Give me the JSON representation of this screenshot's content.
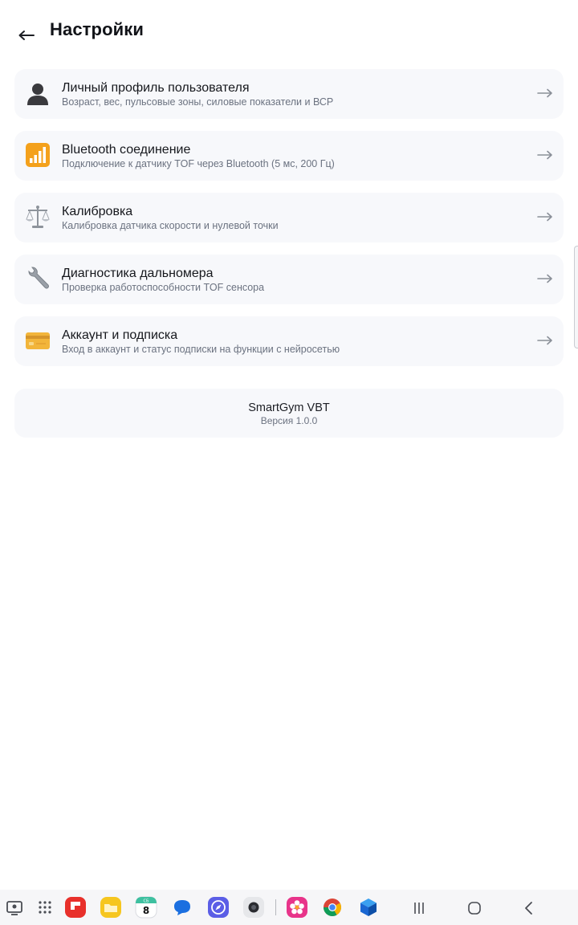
{
  "header": {
    "title": "Настройки"
  },
  "settings": {
    "items": [
      {
        "title": "Личный профиль пользователя",
        "subtitle": "Возраст, вес, пульсовые зоны, силовые показатели и ВСР",
        "icon": "user-silhouette-icon"
      },
      {
        "title": "Bluetooth соединение",
        "subtitle": "Подключение к датчику TOF через Bluetooth (5 мс, 200 Гц)",
        "icon": "signal-bars-icon"
      },
      {
        "title": "Калибровка",
        "subtitle": "Калибровка датчика скорости и нулевой точки",
        "icon": "balance-scale-icon"
      },
      {
        "title": "Диагностика дальномера",
        "subtitle": "Проверка работоспособности TOF сенсора",
        "icon": "wrench-icon"
      },
      {
        "title": "Аккаунт и подписка",
        "subtitle": "Вход в аккаунт и статус подписки на функции с нейросетью",
        "icon": "credit-card-icon"
      }
    ]
  },
  "about": {
    "app_name": "SmartGym VBT",
    "version": "Версия 1.0.0"
  },
  "taskbar": {
    "calendar_day_label": "СБ",
    "calendar_date": "8",
    "apps": [
      "screen-recorder-icon",
      "app-drawer-icon",
      "flipboard-icon",
      "files-icon",
      "calendar-icon",
      "messages-icon",
      "compass-app-icon",
      "camera-icon",
      "photos-icon",
      "chrome-icon",
      "cube-app-icon"
    ],
    "nav": [
      "recents-icon",
      "home-icon",
      "back-icon"
    ]
  },
  "colors": {
    "background": "#ffffff",
    "card": "#f7f8fb",
    "title": "#16181d",
    "subtitle": "#6b7280",
    "taskbar": "#f6f6f8"
  }
}
